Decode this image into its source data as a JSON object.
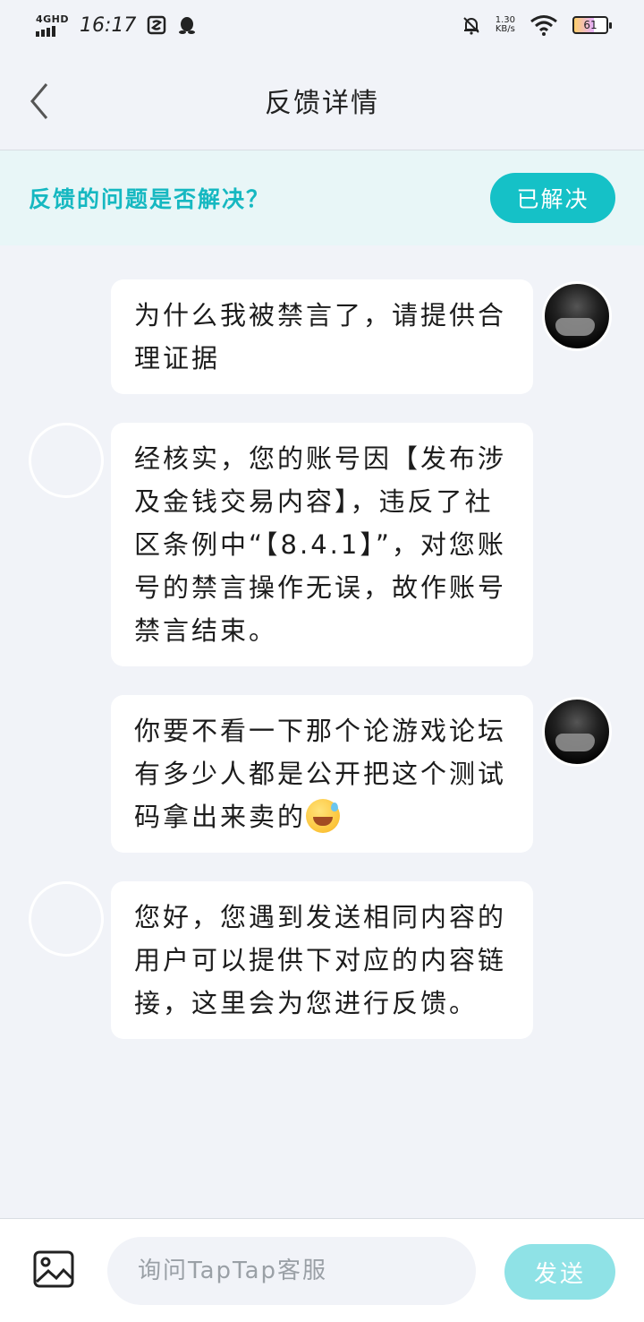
{
  "status_bar": {
    "network": "4GHD",
    "time": "16:17",
    "speed_value": "1.30",
    "speed_unit": "KB/s",
    "battery": "61",
    "battery_level_percent": 61
  },
  "header": {
    "title": "反馈详情"
  },
  "resolve_banner": {
    "question": "反馈的问题是否解决？",
    "resolved_label": "已解决"
  },
  "messages": [
    {
      "sender": "user",
      "text": "为什么我被禁言了，请提供合理证据"
    },
    {
      "sender": "support",
      "text": "经核实，您的账号因【发布涉及金钱交易内容】，违反了社区条例中“【8.4.1】”，对您账号的禁言操作无误，故作账号禁言结束。"
    },
    {
      "sender": "user",
      "text": "你要不看一下那个论游戏论坛有多少人都是公开把这个测试码拿出来卖的"
    },
    {
      "sender": "support",
      "text": "您好，您遇到发送相同内容的用户可以提供下对应的内容链接，这里会为您进行反馈。"
    }
  ],
  "composer": {
    "placeholder": "询问TapTap客服",
    "send_label": "发送"
  },
  "colors": {
    "accent": "#15c1c7",
    "accent_text": "#16b8c1",
    "banner_bg": "#e8f6f7",
    "send_disabled": "#8fe2e6",
    "page_bg": "#f1f3f8"
  }
}
